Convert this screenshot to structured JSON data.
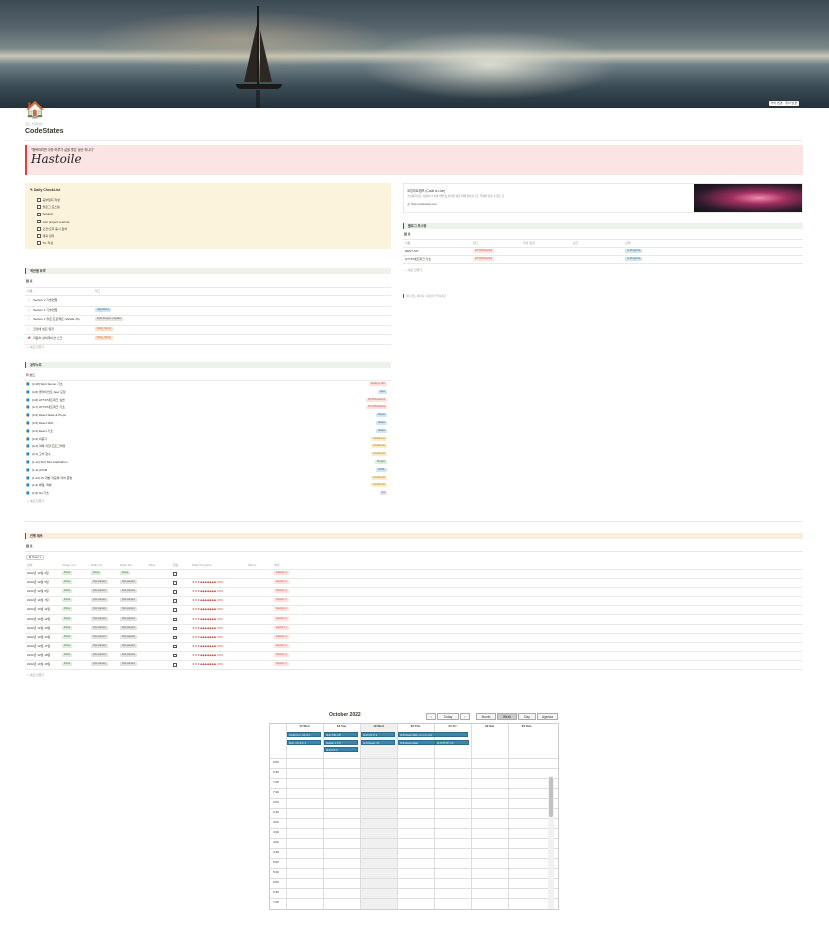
{
  "header": {
    "breadcrumb": "코드 스테이츠",
    "title": "CodeStates",
    "cover_buttons": "커버 변경 · 위치 변경"
  },
  "quote": {
    "text": "\"행복하려면 이를 하루가 삶을 좋은 생산 하나다\"",
    "signature": "Hastoile"
  },
  "checklist": {
    "title": "Daily CheckList",
    "items": [
      "공부일지 작성",
      "블로그 포스팅",
      "Solution",
      "solo project override",
      "오전/오후 동시 참여",
      "계획 정리",
      "TIL 작성"
    ]
  },
  "external": {
    "title": "코딩부트캠프 (Code is Live)",
    "desc": "코딩하지 않는 사람이 IT 분야 취업 및 이직을 하기 위해 필요한 모든 역량을 갖출 수 있는 곳",
    "url": "https://codestates.com"
  },
  "blog_section": {
    "title": "블로그 포스팅",
    "view": "표",
    "columns": [
      "이름",
      "태그",
      "작성 일자",
      "링크",
      "상태"
    ],
    "rows": [
      {
        "name": "REST API",
        "tag": "HTTP/Network",
        "status": "In Progress"
      },
      {
        "name": "HTTP/네트워크 기초",
        "tag": "HTTP/Network",
        "status": "In Progress"
      }
    ],
    "add": "+ 새로 만들기"
  },
  "side_note": "제목 없는 페이지 / 내용을 입력하세요",
  "section_summary": {
    "title": "섹션별 요약",
    "view": "표",
    "columns": [
      "이름",
      "태그"
    ],
    "rows": [
      {
        "icon": "page-icon",
        "name": "Section 2 기술면접",
        "tag": ""
      },
      {
        "icon": "page-icon",
        "name": "Section 1 기술면접",
        "tag": "Algorithms",
        "tagColor": "blue"
      },
      {
        "icon": "page-icon",
        "name": "Section 1 솔로 프로젝트 (Vanilla JS)",
        "tag": "Solo Project | Vanilla",
        "tagColor": "gray"
      },
      {
        "icon": "page-icon",
        "name": "코딩에 필요 일지",
        "tag": "Daily_Study",
        "tagColor": "orange"
      },
      {
        "icon": "pin-icon",
        "name": "자동차 내비게이션 스크",
        "tag": "Daily_Study",
        "tagColor": "orange"
      }
    ],
    "add": "+ 새로 만들기"
  },
  "study_notes": {
    "title": "공부노트",
    "view": "보드",
    "rows": [
      {
        "name": "[3-18] Web Server 기초",
        "tag": "Node.js, API",
        "tagColor": "red"
      },
      {
        "name": "[3-8] 클라이언트 Ajax 요청",
        "tag": "Ajax",
        "tagColor": "blue"
      },
      {
        "name": "[3-8] HTTP/네트워크 실습",
        "tag": "HTTP/Network",
        "tagColor": "red"
      },
      {
        "name": "[3-7] HTTP/네트워크 기초",
        "tag": "HTTP/Network",
        "tagColor": "red"
      },
      {
        "name": "[3-6] React State & Props",
        "tag": "React",
        "tagColor": "blue"
      },
      {
        "name": "[3-5] React SPA",
        "tag": "React",
        "tagColor": "blue"
      },
      {
        "name": "[3-4] React 기초",
        "tag": "React",
        "tagColor": "blue"
      },
      {
        "name": "[3-3] 비동기",
        "tag": "JavaScript",
        "tagColor": "yellow"
      },
      {
        "name": "[3-2] 객체 지향 프로그래밍",
        "tag": "JavaScript",
        "tagColor": "yellow"
      },
      {
        "name": "[3-1] 고차 함수",
        "tag": "JavaScript",
        "tagColor": "yellow"
      },
      {
        "name": "[1-12] Surf Mini Hackathon",
        "tag": "Project",
        "tagColor": "green"
      },
      {
        "name": "[1-11] DOM",
        "tag": "HTML",
        "tagColor": "blue"
      },
      {
        "name": "[1-10] JS 개발 자료와 자바 문법",
        "tag": "JavaScript",
        "tagColor": "yellow"
      },
      {
        "name": "[1-9] 배열, 객체",
        "tag": "JavaScript",
        "tagColor": "yellow"
      },
      {
        "name": "[1-8] Git 기초",
        "tag": "Git",
        "tagColor": "purple"
      }
    ],
    "add": "+ 새로 만들기"
  },
  "progress_table": {
    "title": "진행 체크",
    "view": "표",
    "filter": "Status",
    "columns": [
      "날짜",
      "Today I Le",
      "Daily Co",
      "Daily Stu",
      "Blog",
      "완료",
      "Daily Progress",
      "Memo",
      "섹션"
    ],
    "rows": [
      {
        "date": "2022년 10월 4일",
        "til": "Done",
        "dco": "Done",
        "dst": "Done",
        "done": false,
        "progress": "",
        "section": "Section 1"
      },
      {
        "date": "2022년 10월 5일",
        "til": "Done",
        "dco": "Not started",
        "dst": "Not started",
        "done": false,
        "progress": "★★★◆◆◆◆◆◆◆ 30%",
        "section": "Section 1"
      },
      {
        "date": "2022년 10월 6일",
        "til": "Done",
        "dco": "Not started",
        "dst": "Not started",
        "done": false,
        "progress": "★★★◆◆◆◆◆◆◆ 30%",
        "section": "Section 1"
      },
      {
        "date": "2022년 10월 7일",
        "til": "Done",
        "dco": "Not started",
        "dst": "Not started",
        "done": false,
        "progress": "★★★◆◆◆◆◆◆◆ 30%",
        "section": "Section 1"
      },
      {
        "date": "2022년 10월 11일",
        "til": "Done",
        "dco": "Not started",
        "dst": "Not started",
        "done": false,
        "progress": "★★★◆◆◆◆◆◆◆ 30%",
        "section": "Section 1"
      },
      {
        "date": "2022년 10월 12일",
        "til": "Done",
        "dco": "Not started",
        "dst": "Not started",
        "done": false,
        "progress": "★★★◆◆◆◆◆◆◆ 30%",
        "section": "Section 1"
      },
      {
        "date": "2022년 10월 13일",
        "til": "Done",
        "dco": "Not started",
        "dst": "Not started",
        "done": false,
        "progress": "★★★◆◆◆◆◆◆◆ 30%",
        "section": "Section 1"
      },
      {
        "date": "2022년 10월 14일",
        "til": "Done",
        "dco": "Not started",
        "dst": "Not started",
        "done": false,
        "progress": "★★★◆◆◆◆◆◆◆ 30%",
        "section": "Section 1"
      },
      {
        "date": "2022년 10월 17일",
        "til": "Done",
        "dco": "Not started",
        "dst": "Not started",
        "done": false,
        "progress": "★★★◆◆◆◆◆◆◆ 30%",
        "section": "Section 1"
      },
      {
        "date": "2022년 10월 18일",
        "til": "Done",
        "dco": "Not started",
        "dst": "Not started",
        "done": false,
        "progress": "★★★◆◆◆◆◆◆◆ 30%",
        "section": "Section 1"
      },
      {
        "date": "2022년 10월 19일",
        "til": "Done",
        "dco": "Not started",
        "dst": "Not started",
        "done": false,
        "progress": "★★★◆◆◆◆◆◆◆ 30%",
        "section": "Section 1"
      }
    ],
    "add": "+ 새로 만들기"
  },
  "calendar": {
    "title": "October 2022",
    "prev": "‹",
    "today": "Today",
    "next": "›",
    "views": [
      "Month",
      "Week",
      "Day",
      "Agenda"
    ],
    "active_view": "Week",
    "days": [
      "17 Mon",
      "18 Tue",
      "19 Wed",
      "20 Thu",
      "21 Fri",
      "22 Sat",
      "23 Sun"
    ],
    "events": [
      {
        "day": 0,
        "slot": 0,
        "label": "10:00 [3-1] 고차 함수"
      },
      {
        "day": 0,
        "slot": 1,
        "label": "[3-1] 고차 함수 2"
      },
      {
        "day": 1,
        "slot": 0,
        "label": "[3-2] 객체 지향"
      },
      {
        "day": 1,
        "slot": 1,
        "label": "Section 1 솔로"
      },
      {
        "day": 1,
        "slot": 2,
        "label": "[3-3] 비동기"
      },
      {
        "day": 2,
        "slot": 0,
        "label": "[3-3] 비동기 2"
      },
      {
        "day": 2,
        "slot": 1,
        "label": "[3-4] React 기초"
      },
      {
        "day": 3,
        "slot": 0,
        "label": "[3-5] React SPA 다시 보기 리뷰"
      },
      {
        "day": 3,
        "slot": 1,
        "label": "[3-6] React State"
      },
      {
        "day": 4,
        "slot": 1,
        "label": "[3-7] HTTP 기초"
      }
    ],
    "times": [
      "6:00",
      "6:30",
      "7:00",
      "7:30",
      "2:00",
      "2:30",
      "3:00",
      "3:30",
      "4:00",
      "4:30",
      "5:00",
      "5:30",
      "6:00",
      "6:30",
      "7:00"
    ]
  }
}
